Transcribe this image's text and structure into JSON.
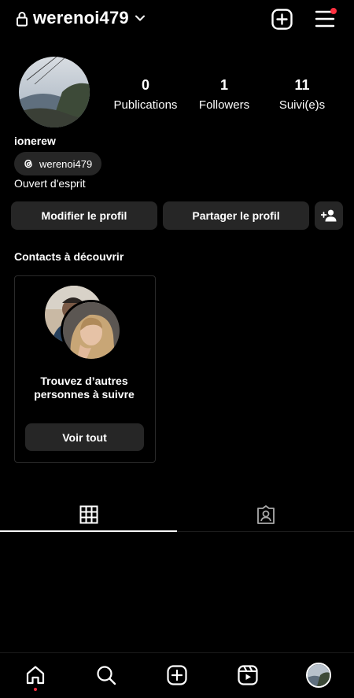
{
  "header": {
    "username": "werenoi479",
    "icons": [
      "lock-icon",
      "chevron-down-icon",
      "new-post-icon",
      "menu-icon"
    ]
  },
  "profile": {
    "stats": [
      {
        "value": "0",
        "label": "Publications"
      },
      {
        "value": "1",
        "label": "Followers"
      },
      {
        "value": "11",
        "label": "Suivi(e)s"
      }
    ],
    "display_name": "ionerew",
    "threads_handle": "werenoi479",
    "bio": "Ouvert d'esprit"
  },
  "actions": {
    "edit_label": "Modifier le profil",
    "share_label": "Partager le profil"
  },
  "suggestions": {
    "title": "Contacts à découvrir",
    "card_text_line1": "Trouvez d’autres",
    "card_text_line2": "personnes à suivre",
    "see_all_label": "Voir tout"
  },
  "tabs": [
    "grid-icon",
    "tagged-icon"
  ],
  "bottom_nav": [
    "home-icon",
    "search-icon",
    "create-icon",
    "reels-icon",
    "profile-avatar"
  ],
  "colors": {
    "background": "#000000",
    "button": "#262626",
    "notification": "#ff3040"
  }
}
